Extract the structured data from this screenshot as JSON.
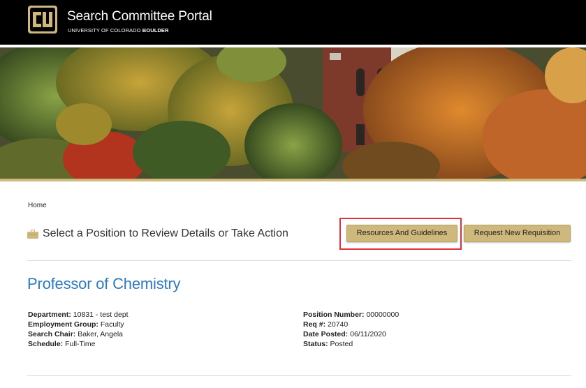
{
  "header": {
    "title": "Search Committee Portal",
    "subtitle_prefix": "UNIVERSITY OF COLORADO",
    "subtitle_bold": "BOULDER",
    "colors": {
      "bar": "#000000",
      "gold": "#CFB87C"
    }
  },
  "breadcrumb": {
    "home": "Home"
  },
  "section": {
    "icon": "briefcase-icon",
    "title": "Select a Position to Review Details or Take Action"
  },
  "buttons": {
    "resources": "Resources And Guidelines",
    "request": "Request New Requisition"
  },
  "position": {
    "title": "Professor of Chemistry",
    "left": [
      {
        "label": "Department:",
        "value": "10831 - test dept"
      },
      {
        "label": "Employment Group:",
        "value": "Faculty"
      },
      {
        "label": "Search Chair:",
        "value": "Baker, Angela"
      },
      {
        "label": "Schedule:",
        "value": "Full-Time"
      }
    ],
    "right": [
      {
        "label": "Position Number:",
        "value": "00000000"
      },
      {
        "label": "Req #:",
        "value": "20740"
      },
      {
        "label": "Date Posted:",
        "value": "06/11/2020"
      },
      {
        "label": "Status:",
        "value": "Posted"
      }
    ]
  },
  "highlight_color": "#E3303B",
  "link_color": "#2F7ABF"
}
